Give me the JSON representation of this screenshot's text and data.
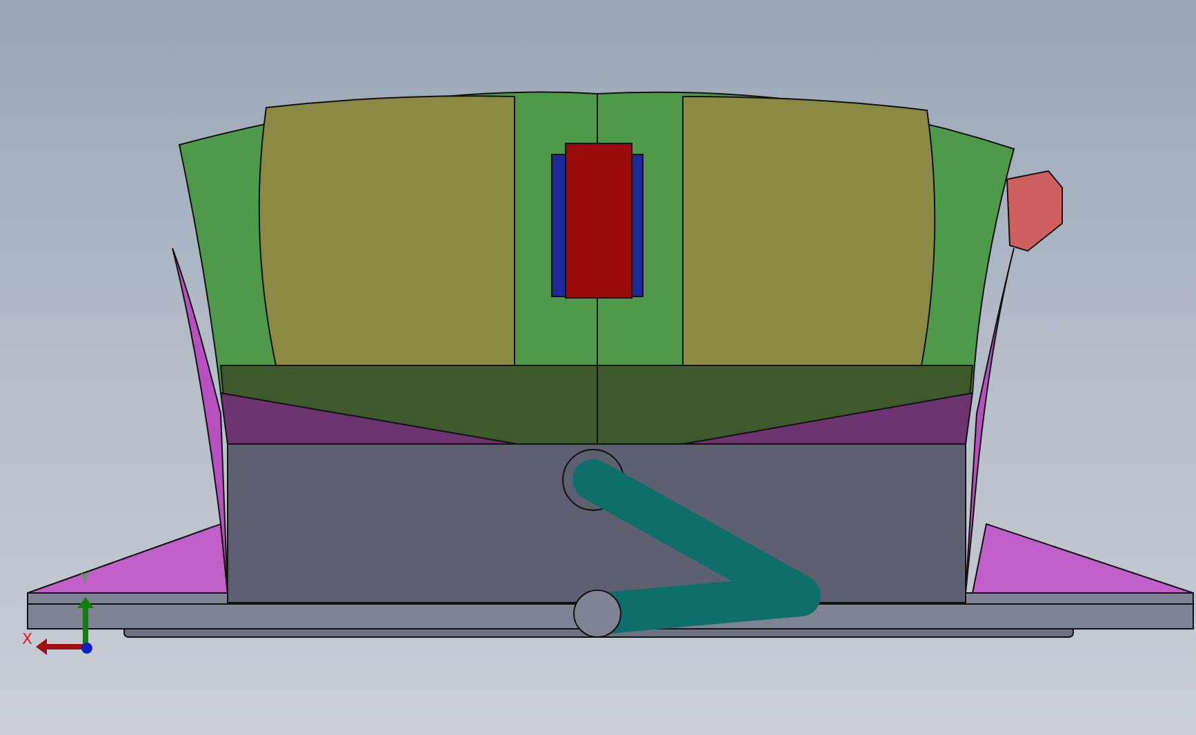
{
  "viewport": {
    "triad": {
      "x_label": "X",
      "y_label": "Y"
    }
  }
}
